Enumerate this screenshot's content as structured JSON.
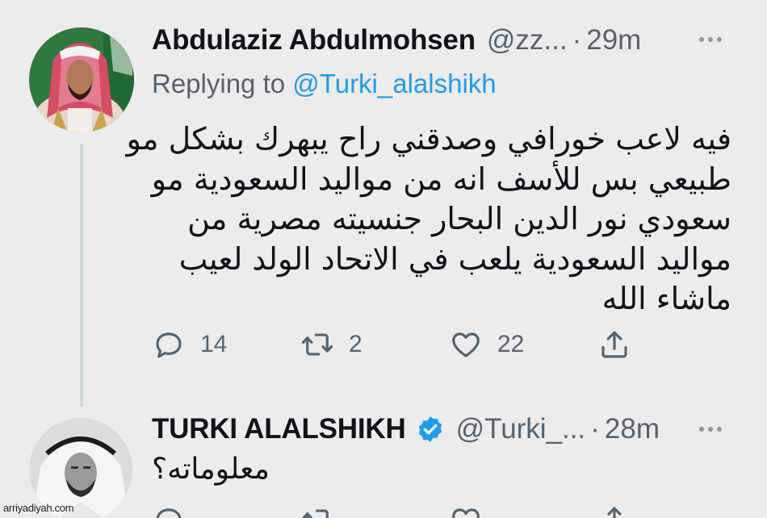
{
  "colors": {
    "accent": "#1d9bf0",
    "muted": "#536471",
    "text": "#0f1419",
    "background": "#ececec"
  },
  "tweet1": {
    "avatar": "avatar-man-in-red-shemagh",
    "display_name": "Abdulaziz Abdulmohsen",
    "handle": "@zz...",
    "separator": "·",
    "time": "29m",
    "replying_prefix": "Replying to",
    "replying_to": "@Turki_alalshikh",
    "text_lines": [
      "فيه لاعب خورافي وصدقني راح يبهرك بشكل مو",
      "طبيعي بس للأسف انه من مواليد السعودية مو",
      "سعودي نور الدين البحار جنسيته مصرية من",
      "مواليد السعودية يلعب في الاتحاد الولد لعيب",
      "ماشاء الله"
    ],
    "actions": {
      "reply_count": "14",
      "retweet_count": "2",
      "like_count": "22",
      "share_icon": "share-icon"
    }
  },
  "tweet2": {
    "avatar": "avatar-man-in-white-shemagh",
    "display_name": "TURKI ALALSHIKH",
    "verified_icon": "verified-badge-icon",
    "handle": "@Turki_...",
    "separator": "·",
    "time": "28m",
    "text": "معلوماته؟"
  },
  "watermark": "arriyadiyah.com"
}
